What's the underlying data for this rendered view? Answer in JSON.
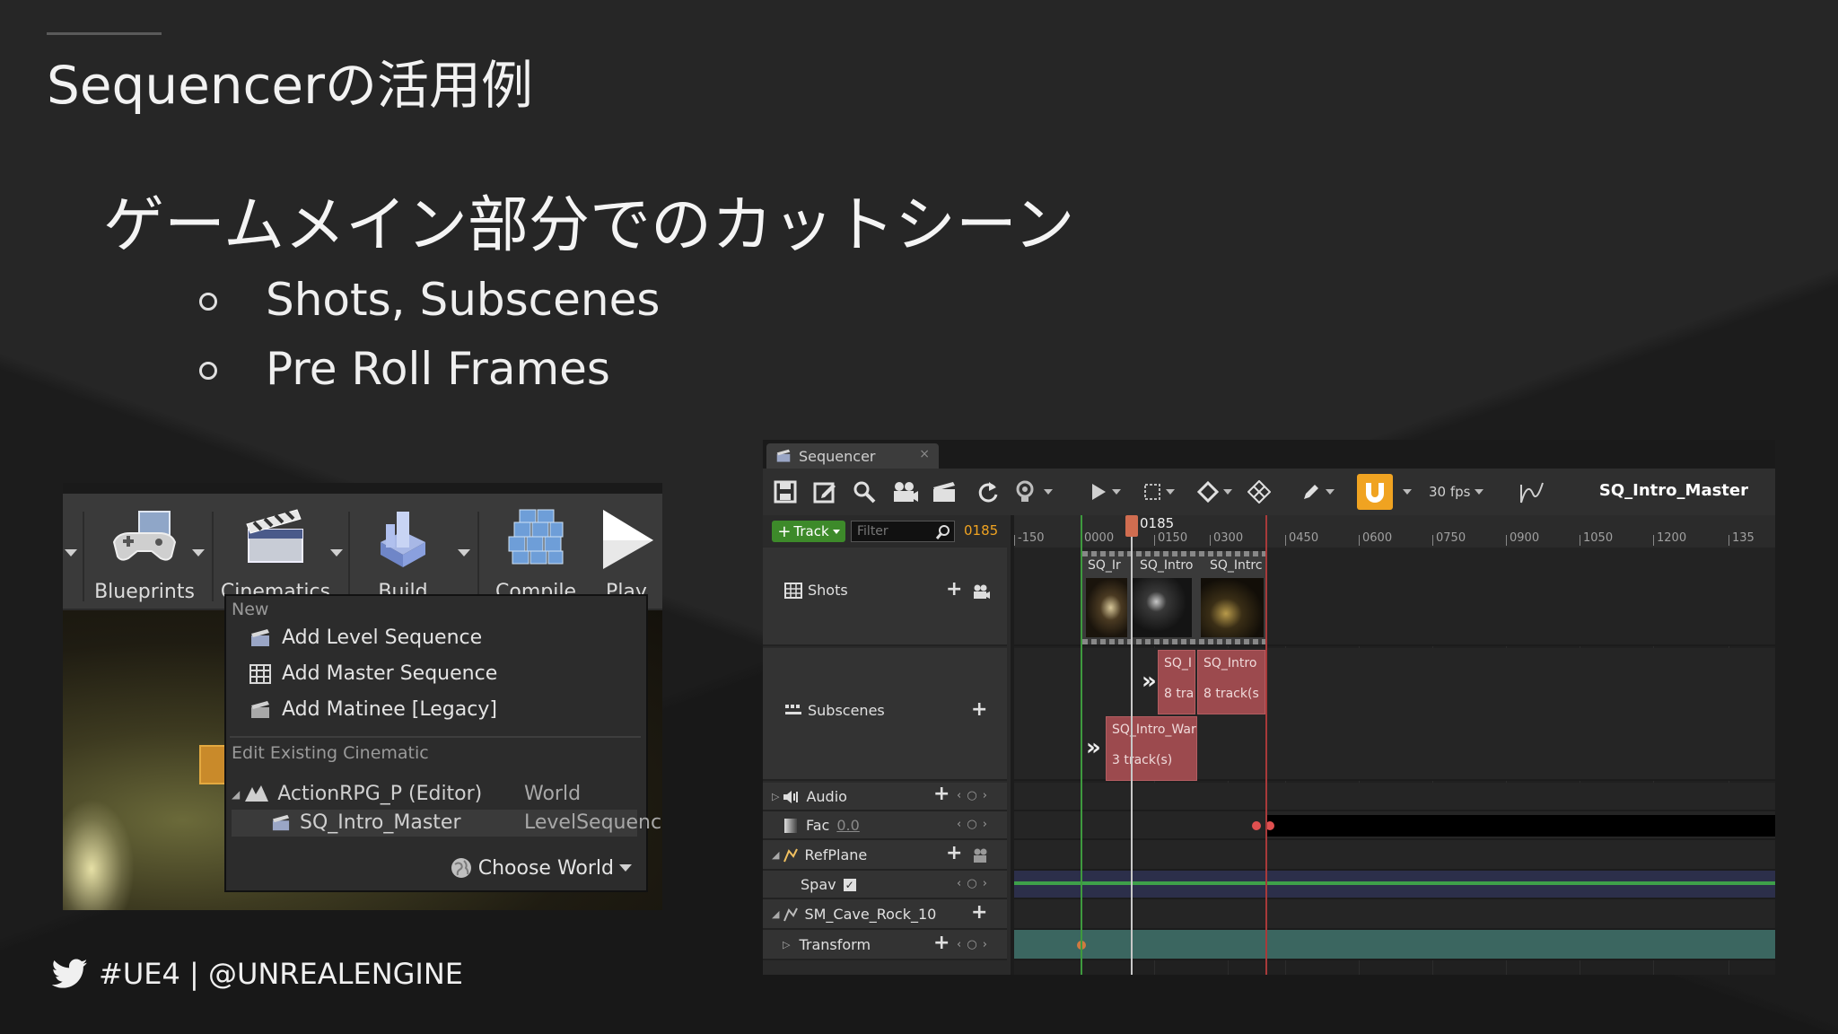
{
  "slide": {
    "title": "Sequencerの活用例",
    "heading": "ゲームメイン部分でのカットシーン",
    "bullets": [
      "Shots, Subscenes",
      "Pre Roll Frames"
    ],
    "footer": "#UE4 | @UNREALENGINE"
  },
  "editor_toolbar": {
    "buttons": [
      {
        "label": "Blueprints",
        "icon": "blueprints-icon"
      },
      {
        "label": "Cinematics",
        "icon": "clapperboard-icon"
      },
      {
        "label": "Build",
        "icon": "build-icon"
      },
      {
        "label": "Compile",
        "icon": "compile-icon"
      },
      {
        "label": "Play",
        "icon": "play-icon"
      }
    ]
  },
  "cinematics_menu": {
    "section_new": "New",
    "items": [
      {
        "label": "Add Level Sequence",
        "icon": "level-sequence-icon"
      },
      {
        "label": "Add Master Sequence",
        "icon": "master-sequence-icon"
      },
      {
        "label": "Add Matinee [Legacy]",
        "icon": "matinee-icon"
      }
    ],
    "section_edit": "Edit Existing Cinematic",
    "existing": [
      {
        "name": "ActionRPG_P (Editor)",
        "type": "World",
        "icon": "world-actor-icon"
      },
      {
        "name": "SQ_Intro_Master",
        "type": "LevelSequenc",
        "icon": "level-sequence-icon",
        "selected": true
      }
    ],
    "choose_world": "Choose World"
  },
  "sequencer": {
    "tab_label": "Sequencer",
    "sequence_name": "SQ_Intro_Master",
    "fps": "30 fps",
    "add_track_label": "Track",
    "filter_placeholder": "Filter",
    "current_frame": "0185",
    "ruler_ticks": [
      "-150",
      "0000",
      "0150",
      "0300",
      "0450",
      "0600",
      "0750",
      "0900",
      "1050",
      "1200",
      "135"
    ],
    "tracks": [
      {
        "name": "Shots"
      },
      {
        "name": "Subscenes"
      },
      {
        "name": "Audio"
      },
      {
        "name": "Fac",
        "value": "0.0"
      },
      {
        "name": "RefPlane"
      },
      {
        "name": "Spav"
      },
      {
        "name": "SM_Cave_Rock_10"
      },
      {
        "name": "Transform"
      }
    ],
    "shot_clips": [
      "SQ_Ir",
      "SQ_Intro",
      "SQ_Intrc"
    ],
    "subscene_clips": [
      {
        "name": "SQ_I",
        "tracks": "8 tra"
      },
      {
        "name": "SQ_Intro",
        "tracks": "8 track(s"
      },
      {
        "name": "SQ_Intro_War",
        "tracks": "3 track(s)"
      }
    ],
    "keyframe_nav": "‹ ○ ›"
  },
  "colors": {
    "accent_orange": "#f0a321",
    "clip_red": "#9c4a4e",
    "add_green": "#3d8a2a"
  }
}
